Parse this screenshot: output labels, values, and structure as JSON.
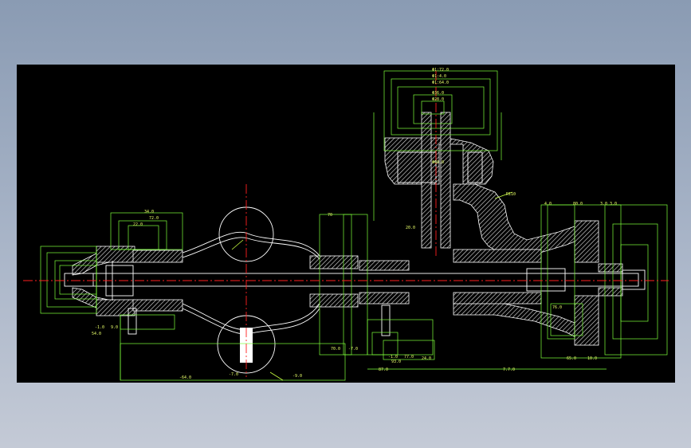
{
  "drawing": {
    "background": "#000000",
    "colors": {
      "outline": "#ffffff",
      "hatch": "#d8d8d8",
      "dimension": "#7dff3a",
      "dimension_text": "#e8ff6a",
      "centerline": "#ff2020",
      "leader": "#c8ff40"
    },
    "dimension_labels": {
      "top_d1": "Φ1:72.0",
      "top_d2": "Φ1:4.0",
      "top_d3": "Φ1:64.0",
      "top_d4": "Φ36.0",
      "top_d5": "Φ28.0",
      "top_d6": "Φ60.0",
      "elbow_r": "R110",
      "left_w1": "34.0",
      "left_w2": "72.0",
      "left_w3": "22.0",
      "mid_a": "70",
      "mid_b": "20.0",
      "right_a": "80.0",
      "right_b": "3.0 3.0",
      "right_c": "4.0",
      "right_d": "76.0",
      "right_e": "65.0",
      "right_f": "10.0",
      "bot_a": "-1.0",
      "bot_b": "9.0",
      "bot_c": "54.0",
      "bot_d": "-64.0",
      "bot_e": "-7.0",
      "bot_f": "-9.0",
      "bot_g": "70.0",
      "bot_h": "-7.0",
      "bot_i": "-1.0",
      "bot_j": "77.0",
      "bot_k": "24.0",
      "bot_l": "93.0",
      "bot_m": "87.0",
      "bot_n": "7.7.0"
    }
  }
}
